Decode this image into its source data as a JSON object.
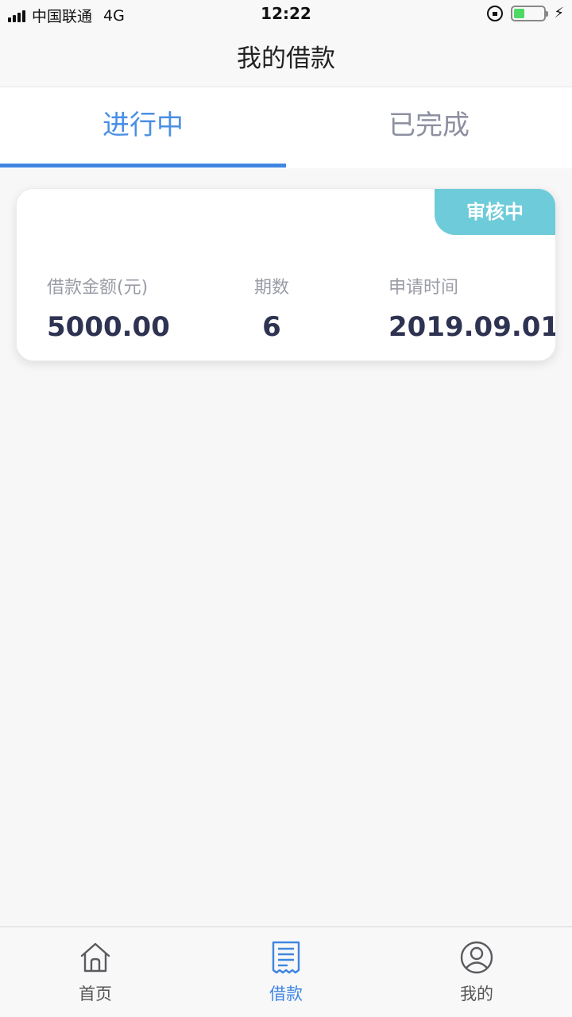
{
  "status_bar": {
    "carrier": "中国联通",
    "network": "4G",
    "time": "12:22",
    "battery_level": 0.35,
    "icons": [
      "signal-icon",
      "rotation-lock-icon",
      "battery-icon",
      "charging-bolt-icon"
    ]
  },
  "header": {
    "title": "我的借款"
  },
  "tabs": [
    {
      "label": "进行中",
      "active": true
    },
    {
      "label": "已完成",
      "active": false
    }
  ],
  "loan_card": {
    "status": "审核中",
    "amount_label": "借款金额(元)",
    "amount": "5000.00",
    "periods_label": "期数",
    "periods": "6",
    "date_label": "申请时间",
    "date": "2019.09.01"
  },
  "tab_bar": {
    "items": [
      {
        "label": "首页",
        "icon": "home-icon",
        "active": false
      },
      {
        "label": "借款",
        "icon": "receipt-icon",
        "active": true
      },
      {
        "label": "我的",
        "icon": "user-icon",
        "active": false
      }
    ]
  },
  "colors": {
    "accent": "#3f86e0",
    "badge": "#6ecbd9",
    "value_text": "#2f3352",
    "inactive_tab": "#8c90a0"
  }
}
